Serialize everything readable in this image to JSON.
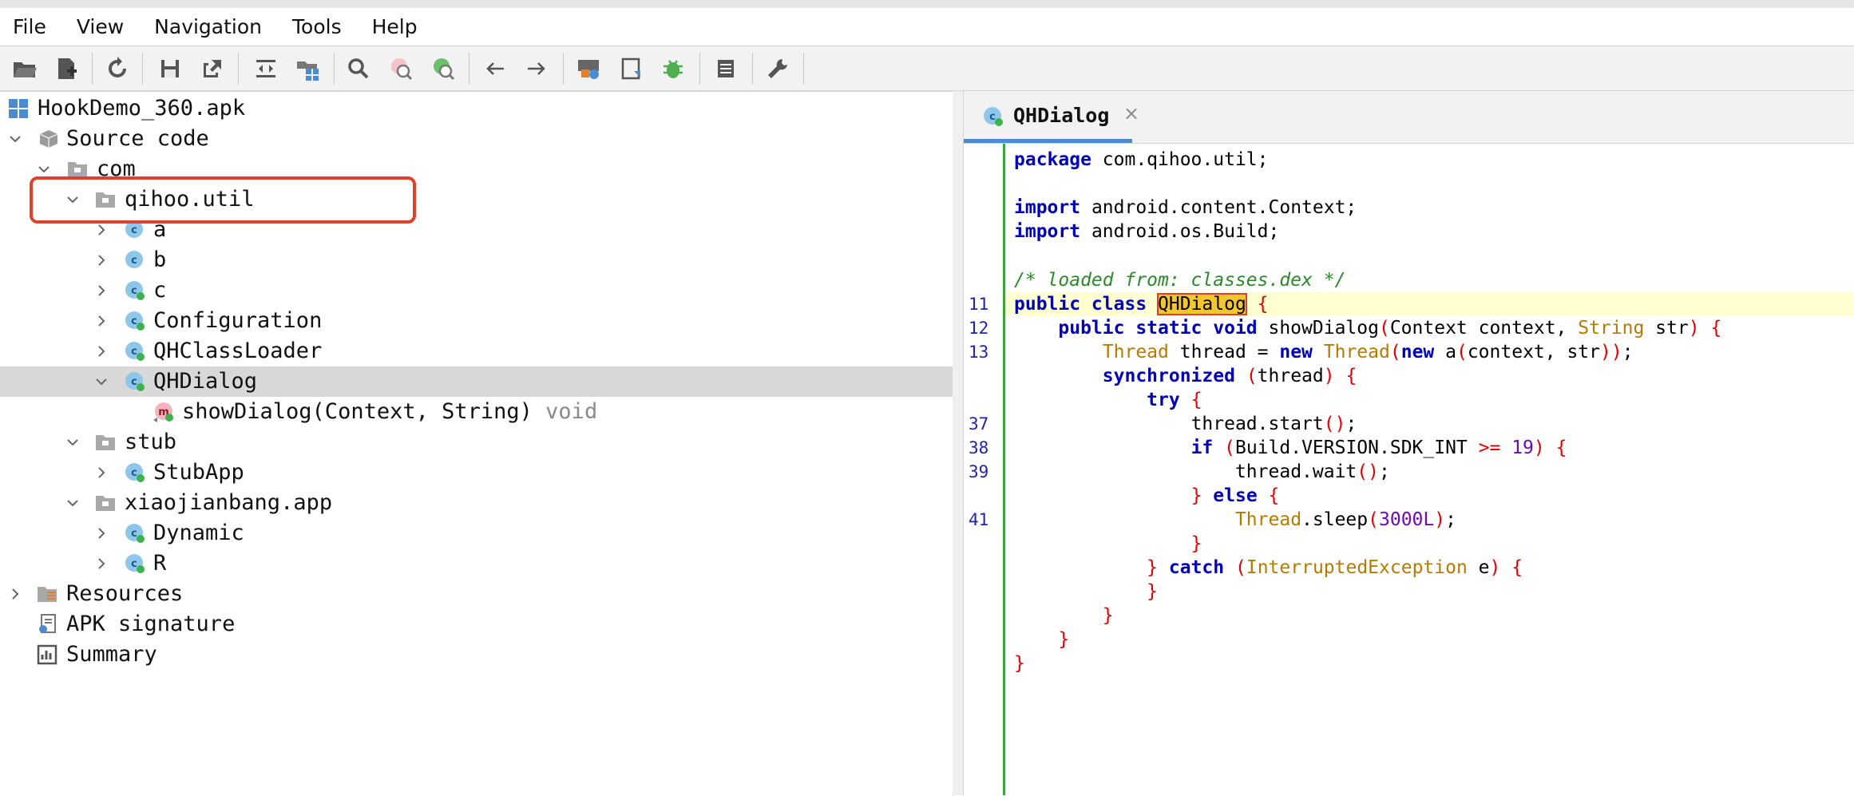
{
  "menu": {
    "items": [
      "File",
      "View",
      "Navigation",
      "Tools",
      "Help"
    ]
  },
  "toolbar": {
    "buttons": [
      "open-folder-icon",
      "add-file-icon",
      "sync-icon",
      "save-icon",
      "export-icon",
      "expand-icon",
      "folder-grid-icon",
      "search-icon",
      "find-class-icon",
      "find-usage-icon",
      "back-arrow-icon",
      "forward-arrow-icon",
      "settings-lock-icon",
      "deobfuscation-icon",
      "debug-bug-icon",
      "log-icon",
      "wrench-icon"
    ]
  },
  "tree": {
    "root": "HookDemo_360.apk",
    "source_code": "Source code",
    "com": "com",
    "qihoo_util": "qihoo.util",
    "cls_a": "a",
    "cls_b": "b",
    "cls_c": "c",
    "cls_configuration": "Configuration",
    "cls_qhclassloader": "QHClassLoader",
    "cls_qhdialog": "QHDialog",
    "method_showdialog": "showDialog(Context, String)",
    "method_return": "void",
    "stub": "stub",
    "cls_stubapp": "StubApp",
    "xiaojianbang_app": "xiaojianbang.app",
    "cls_dynamic": "Dynamic",
    "cls_r": "R",
    "resources": "Resources",
    "apk_signature": "APK signature",
    "summary": "Summary"
  },
  "editor": {
    "tab_title": "QHDialog",
    "tab_close": "×",
    "line_numbers": {
      "l11": "11",
      "l12": "12",
      "l13": "13",
      "l37": "37",
      "l38": "38",
      "l39": "39",
      "l41": "41"
    },
    "code": {
      "package_kw": "package",
      "package_name": " com.qihoo.util;",
      "import_kw": "import",
      "import1": " android.content.Context;",
      "import2": " android.os.Build;",
      "comment": "/* loaded from: classes.dex */",
      "public_class": "public class",
      "class_name": "QHDialog",
      "public_static_void": "public static void",
      "method_sig_a": " showDialog",
      "method_sig_b": "Context context, ",
      "method_sig_type": "String",
      "method_sig_c": " str",
      "thread_type": "Thread",
      "thread_assign": " thread = ",
      "new_kw": "new",
      "thread_new_a": "(",
      "new_a": " a",
      "context_str": "context, str",
      "synchronized_kw": "synchronized",
      "sync_arg": "thread",
      "try_kw": "try",
      "thread_start": "thread.start",
      "if_kw": "if",
      "if_cond": "Build.VERSION.SDK_INT ",
      "ge_op": ">=",
      "sdk_num": "19",
      "thread_wait": "thread.wait",
      "else_kw": "else",
      "sleep_method": ".sleep",
      "sleep_num": "3000L",
      "catch_kw": "catch",
      "exception_type": "InterruptedException",
      "exception_var": " e"
    }
  },
  "colors": {
    "accent_tab": "#4a8ccf",
    "highlight_box": "#e0412f",
    "keyword": "#0000b8",
    "comment": "#2a8a2a",
    "type": "#b57b00",
    "brace": "#e20000"
  }
}
